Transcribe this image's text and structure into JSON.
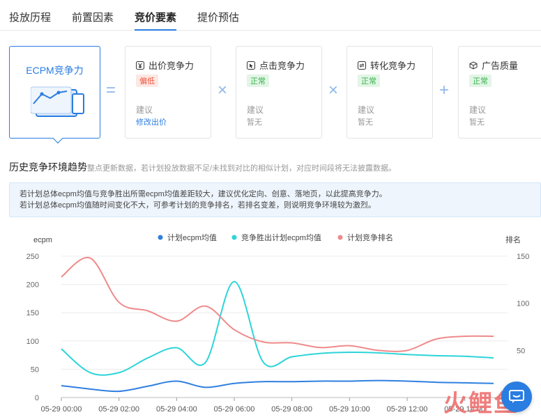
{
  "tabs": [
    {
      "label": "投放历程"
    },
    {
      "label": "前置因素"
    },
    {
      "label": "竞价要素",
      "active": true
    },
    {
      "label": "提价预估"
    }
  ],
  "ecpm_card": {
    "title": "ECPM竞争力"
  },
  "operators": [
    "=",
    "×",
    "×",
    "+"
  ],
  "factors": [
    {
      "name": "出价竞争力",
      "icon": "yen-icon",
      "status": "偏低",
      "status_type": "warn",
      "suggest_label": "建议",
      "action": "修改出价",
      "action_link": true
    },
    {
      "name": "点击竞争力",
      "icon": "click-icon",
      "status": "正常",
      "status_type": "ok",
      "suggest_label": "建议",
      "action": "暂无",
      "action_link": false
    },
    {
      "name": "转化竞争力",
      "icon": "convert-icon",
      "status": "正常",
      "status_type": "ok",
      "suggest_label": "建议",
      "action": "暂无",
      "action_link": false
    },
    {
      "name": "广告质量",
      "icon": "cube-icon",
      "status": "正常",
      "status_type": "ok",
      "suggest_label": "建议",
      "action": "暂无",
      "action_link": false
    }
  ],
  "section": {
    "title": "历史竞争环境趋势",
    "hint": "整点更新数据，若计划投放数据不足/未找到对比的相似计划，对应时间段将无法披露数据。"
  },
  "tip": {
    "line1": "若计划总体ecpm均值与竞争胜出所需ecpm均值差距较大，建议优化定向、创意、落地页，以此提高竞争力。",
    "line2": "若计划总体ecpm均值随时间变化不大，可参考计划的竞争排名，若排名变差，则说明竞争环境较为激烈。"
  },
  "watermark": "火鲤鱼",
  "colors": {
    "accent": "#2a7de1",
    "series1": "#2f7fe0",
    "series2": "#2dd4d8",
    "series3": "#ef8a8a"
  },
  "chart_data": {
    "type": "line",
    "ylabel_left": "ecpm",
    "ylabel_right": "排名",
    "ylim_left": [
      0,
      250
    ],
    "ylim_right": [
      0,
      150
    ],
    "yticks_left": [
      0,
      50,
      100,
      150,
      200,
      250
    ],
    "yticks_right": [
      50,
      100,
      150
    ],
    "x_ticks": [
      "05-29 00:00",
      "05-29 02:00",
      "05-29 04:00",
      "05-29 06:00",
      "05-29 08:00",
      "05-29 10:00",
      "05-29 12:00",
      "05-29 14:00"
    ],
    "x": [
      0,
      1,
      2,
      3,
      4,
      5,
      6,
      7,
      8,
      9,
      10,
      11,
      12,
      13,
      14,
      15
    ],
    "series": [
      {
        "name": "计划ecpm均值",
        "axis": "left",
        "values": [
          21,
          15,
          11,
          20,
          29,
          18,
          25,
          28,
          28,
          29,
          29,
          30,
          29,
          27,
          26,
          25
        ]
      },
      {
        "name": "竞争胜出计划ecpm均值",
        "axis": "left",
        "values": [
          86,
          44,
          44,
          70,
          88,
          62,
          205,
          63,
          72,
          78,
          80,
          79,
          76,
          74,
          73,
          70
        ]
      },
      {
        "name": "计划竞争排名",
        "axis": "right",
        "values": [
          128,
          148,
          101,
          92,
          81,
          97,
          72,
          59,
          58,
          53,
          55,
          50,
          50,
          62,
          65,
          65
        ]
      }
    ]
  }
}
